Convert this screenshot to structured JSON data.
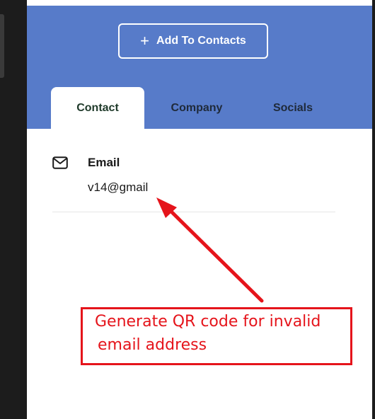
{
  "header": {
    "add_button_label": "Add To Contacts",
    "add_button_icon": "plus-icon",
    "background_color": "#577bc9"
  },
  "tabs": [
    {
      "label": "Contact",
      "active": true
    },
    {
      "label": "Company",
      "active": false
    },
    {
      "label": "Socials",
      "active": false
    }
  ],
  "contact": {
    "email_icon": "mail-icon",
    "email_label": "Email",
    "email_value": "v14@gmail"
  },
  "annotation": {
    "line1": "Generate QR code for invalid",
    "line2": "email address",
    "color": "#e5141b"
  }
}
